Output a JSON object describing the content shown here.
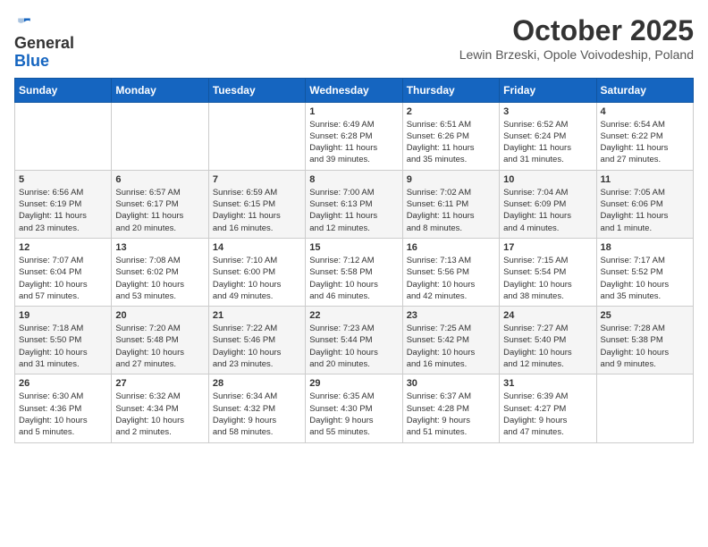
{
  "header": {
    "logo": {
      "line1": "General",
      "line2": "Blue"
    },
    "month": "October 2025",
    "location": "Lewin Brzeski, Opole Voivodeship, Poland"
  },
  "weekdays": [
    "Sunday",
    "Monday",
    "Tuesday",
    "Wednesday",
    "Thursday",
    "Friday",
    "Saturday"
  ],
  "weeks": [
    [
      {
        "day": "",
        "info": ""
      },
      {
        "day": "",
        "info": ""
      },
      {
        "day": "",
        "info": ""
      },
      {
        "day": "1",
        "info": "Sunrise: 6:49 AM\nSunset: 6:28 PM\nDaylight: 11 hours\nand 39 minutes."
      },
      {
        "day": "2",
        "info": "Sunrise: 6:51 AM\nSunset: 6:26 PM\nDaylight: 11 hours\nand 35 minutes."
      },
      {
        "day": "3",
        "info": "Sunrise: 6:52 AM\nSunset: 6:24 PM\nDaylight: 11 hours\nand 31 minutes."
      },
      {
        "day": "4",
        "info": "Sunrise: 6:54 AM\nSunset: 6:22 PM\nDaylight: 11 hours\nand 27 minutes."
      }
    ],
    [
      {
        "day": "5",
        "info": "Sunrise: 6:56 AM\nSunset: 6:19 PM\nDaylight: 11 hours\nand 23 minutes."
      },
      {
        "day": "6",
        "info": "Sunrise: 6:57 AM\nSunset: 6:17 PM\nDaylight: 11 hours\nand 20 minutes."
      },
      {
        "day": "7",
        "info": "Sunrise: 6:59 AM\nSunset: 6:15 PM\nDaylight: 11 hours\nand 16 minutes."
      },
      {
        "day": "8",
        "info": "Sunrise: 7:00 AM\nSunset: 6:13 PM\nDaylight: 11 hours\nand 12 minutes."
      },
      {
        "day": "9",
        "info": "Sunrise: 7:02 AM\nSunset: 6:11 PM\nDaylight: 11 hours\nand 8 minutes."
      },
      {
        "day": "10",
        "info": "Sunrise: 7:04 AM\nSunset: 6:09 PM\nDaylight: 11 hours\nand 4 minutes."
      },
      {
        "day": "11",
        "info": "Sunrise: 7:05 AM\nSunset: 6:06 PM\nDaylight: 11 hours\nand 1 minute."
      }
    ],
    [
      {
        "day": "12",
        "info": "Sunrise: 7:07 AM\nSunset: 6:04 PM\nDaylight: 10 hours\nand 57 minutes."
      },
      {
        "day": "13",
        "info": "Sunrise: 7:08 AM\nSunset: 6:02 PM\nDaylight: 10 hours\nand 53 minutes."
      },
      {
        "day": "14",
        "info": "Sunrise: 7:10 AM\nSunset: 6:00 PM\nDaylight: 10 hours\nand 49 minutes."
      },
      {
        "day": "15",
        "info": "Sunrise: 7:12 AM\nSunset: 5:58 PM\nDaylight: 10 hours\nand 46 minutes."
      },
      {
        "day": "16",
        "info": "Sunrise: 7:13 AM\nSunset: 5:56 PM\nDaylight: 10 hours\nand 42 minutes."
      },
      {
        "day": "17",
        "info": "Sunrise: 7:15 AM\nSunset: 5:54 PM\nDaylight: 10 hours\nand 38 minutes."
      },
      {
        "day": "18",
        "info": "Sunrise: 7:17 AM\nSunset: 5:52 PM\nDaylight: 10 hours\nand 35 minutes."
      }
    ],
    [
      {
        "day": "19",
        "info": "Sunrise: 7:18 AM\nSunset: 5:50 PM\nDaylight: 10 hours\nand 31 minutes."
      },
      {
        "day": "20",
        "info": "Sunrise: 7:20 AM\nSunset: 5:48 PM\nDaylight: 10 hours\nand 27 minutes."
      },
      {
        "day": "21",
        "info": "Sunrise: 7:22 AM\nSunset: 5:46 PM\nDaylight: 10 hours\nand 23 minutes."
      },
      {
        "day": "22",
        "info": "Sunrise: 7:23 AM\nSunset: 5:44 PM\nDaylight: 10 hours\nand 20 minutes."
      },
      {
        "day": "23",
        "info": "Sunrise: 7:25 AM\nSunset: 5:42 PM\nDaylight: 10 hours\nand 16 minutes."
      },
      {
        "day": "24",
        "info": "Sunrise: 7:27 AM\nSunset: 5:40 PM\nDaylight: 10 hours\nand 12 minutes."
      },
      {
        "day": "25",
        "info": "Sunrise: 7:28 AM\nSunset: 5:38 PM\nDaylight: 10 hours\nand 9 minutes."
      }
    ],
    [
      {
        "day": "26",
        "info": "Sunrise: 6:30 AM\nSunset: 4:36 PM\nDaylight: 10 hours\nand 5 minutes."
      },
      {
        "day": "27",
        "info": "Sunrise: 6:32 AM\nSunset: 4:34 PM\nDaylight: 10 hours\nand 2 minutes."
      },
      {
        "day": "28",
        "info": "Sunrise: 6:34 AM\nSunset: 4:32 PM\nDaylight: 9 hours\nand 58 minutes."
      },
      {
        "day": "29",
        "info": "Sunrise: 6:35 AM\nSunset: 4:30 PM\nDaylight: 9 hours\nand 55 minutes."
      },
      {
        "day": "30",
        "info": "Sunrise: 6:37 AM\nSunset: 4:28 PM\nDaylight: 9 hours\nand 51 minutes."
      },
      {
        "day": "31",
        "info": "Sunrise: 6:39 AM\nSunset: 4:27 PM\nDaylight: 9 hours\nand 47 minutes."
      },
      {
        "day": "",
        "info": ""
      }
    ]
  ]
}
